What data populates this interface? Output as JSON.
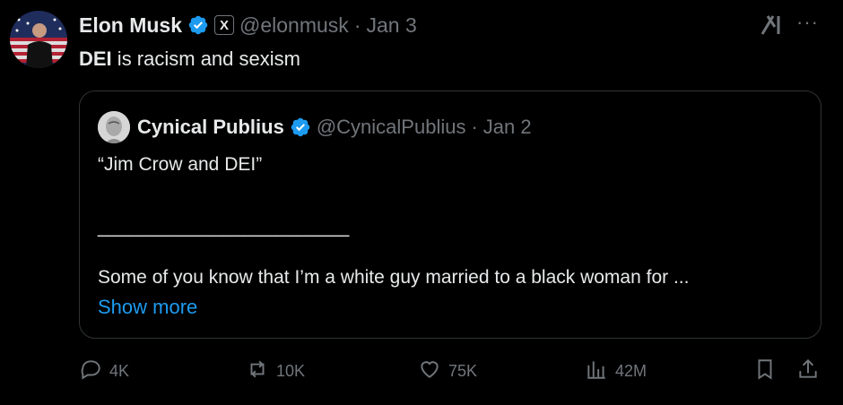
{
  "tweet": {
    "author_name": "Elon Musk",
    "x_badge": "X",
    "handle": "@elonmusk",
    "separator": "·",
    "date": "Jan 3",
    "text_bold": "DEI",
    "text_rest": " is racism and sexism",
    "more_label": "···"
  },
  "quote": {
    "author_name": "Cynical Publius",
    "handle": "@CynicalPublius",
    "separator": "·",
    "date": "Jan 2",
    "line1": "“Jim Crow and DEI”",
    "line2": "________________________",
    "line3": "Some of you know that I’m a white guy married to a black woman for ...",
    "show_more": "Show more"
  },
  "actions": {
    "replies": "4K",
    "reposts": "10K",
    "likes": "75K",
    "views": "42M"
  },
  "colors": {
    "background": "#000000",
    "text": "#e7e9ea",
    "muted": "#71767b",
    "accent": "#1d9bf0",
    "border": "#2f3336"
  },
  "icons": [
    "verified-badge-icon",
    "grok-icon",
    "more-icon",
    "reply-icon",
    "repost-icon",
    "like-icon",
    "views-icon",
    "bookmark-icon",
    "share-icon"
  ]
}
